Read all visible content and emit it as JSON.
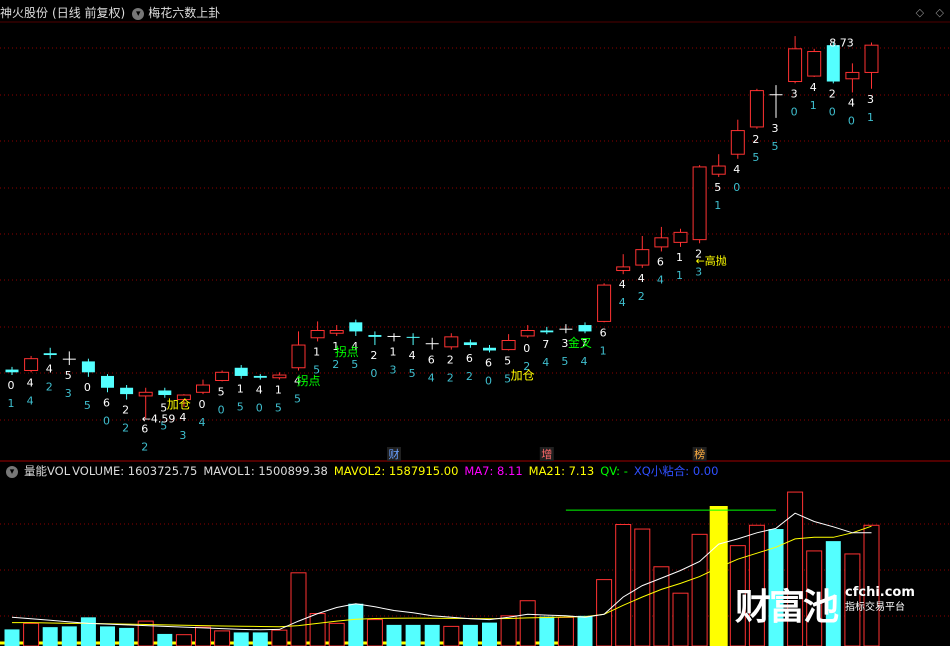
{
  "header": {
    "stock": "神火股份",
    "period": "(日线 前复权)",
    "indicator": "梅花六数上卦"
  },
  "volume_header": {
    "name": "量能VOL",
    "volume": "VOLUME: 1603725.75",
    "mavol1": "MAVOL1: 1500899.38",
    "mavol2": "MAVOL2: 1587915.00",
    "ma7": "MA7: 8.11",
    "ma21": "MA21: 7.13",
    "qv": "QV: -",
    "xq": "XQ小粘合: 0.00"
  },
  "watermark": {
    "brand": "财富池",
    "site": "cfchi.com",
    "tagline": "指标交易平台"
  },
  "colors": {
    "up": "#ff3232",
    "down": "#54ffff",
    "flat": "#ffffff",
    "signal": "#ffff00",
    "guai": "#00ff00",
    "mavol1": "#ffffff",
    "mavol2": "#ffff00",
    "ma7": "#ff00ff",
    "ma21": "#ffff00",
    "xq": "#0000ff",
    "gridline": "#8b0000",
    "annotation_white": "#ffffff"
  },
  "chart_data": [
    {
      "type": "candlestick",
      "price_range": [
        4.3,
        8.9
      ],
      "high_label": "8.73",
      "low_label": "4.59",
      "candles": [
        {
          "o": 5.13,
          "c": 5.1,
          "h": 5.16,
          "l": 5.07,
          "n1": "0",
          "n2": "1"
        },
        {
          "o": 5.12,
          "c": 5.25,
          "h": 5.28,
          "l": 5.1,
          "n1": "4",
          "n2": "4"
        },
        {
          "o": 5.31,
          "c": 5.29,
          "h": 5.37,
          "l": 5.25,
          "n1": "4",
          "n2": "2"
        },
        {
          "o": 5.25,
          "c": 5.25,
          "h": 5.33,
          "l": 5.18,
          "n1": "5",
          "n2": "3"
        },
        {
          "o": 5.22,
          "c": 5.1,
          "h": 5.25,
          "l": 5.05,
          "n1": "0",
          "n2": "5"
        },
        {
          "o": 5.06,
          "c": 4.93,
          "h": 5.08,
          "l": 4.88,
          "n1": "6",
          "n2": "0"
        },
        {
          "o": 4.93,
          "c": 4.86,
          "h": 4.96,
          "l": 4.8,
          "n1": "2",
          "n2": "2"
        },
        {
          "o": 4.84,
          "c": 4.88,
          "h": 4.93,
          "l": 4.59,
          "n1": "6",
          "n2": "2"
        },
        {
          "o": 4.9,
          "c": 4.85,
          "h": 4.93,
          "l": 4.82,
          "n1": "5",
          "n2": "5"
        },
        {
          "o": 4.8,
          "c": 4.85,
          "h": 4.86,
          "l": 4.72,
          "n1": "4",
          "n2": "3"
        },
        {
          "o": 4.88,
          "c": 4.96,
          "h": 5.02,
          "l": 4.86,
          "n1": "0",
          "n2": "4"
        },
        {
          "o": 5.01,
          "c": 5.1,
          "h": 5.12,
          "l": 5.0,
          "n1": "5",
          "n2": "0"
        },
        {
          "o": 5.15,
          "c": 5.06,
          "h": 5.18,
          "l": 5.03,
          "n1": "1",
          "n2": "5"
        },
        {
          "o": 5.06,
          "c": 5.04,
          "h": 5.08,
          "l": 5.02,
          "n1": "4",
          "n2": "0"
        },
        {
          "o": 5.04,
          "c": 5.07,
          "h": 5.1,
          "l": 5.02,
          "n1": "1",
          "n2": "5"
        },
        {
          "o": 5.15,
          "c": 5.4,
          "h": 5.55,
          "l": 5.12,
          "n1": "4",
          "n2": "5"
        },
        {
          "o": 5.48,
          "c": 5.56,
          "h": 5.66,
          "l": 5.44,
          "n1": "1",
          "n2": "5"
        },
        {
          "o": 5.53,
          "c": 5.56,
          "h": 5.62,
          "l": 5.5,
          "n1": "1",
          "n2": "2"
        },
        {
          "o": 5.65,
          "c": 5.55,
          "h": 5.68,
          "l": 5.5,
          "n1": "4",
          "n2": "5"
        },
        {
          "o": 5.51,
          "c": 5.49,
          "h": 5.55,
          "l": 5.4,
          "n1": "2",
          "n2": "0"
        },
        {
          "o": 5.5,
          "c": 5.5,
          "h": 5.53,
          "l": 5.44,
          "n1": "1",
          "n2": "3"
        },
        {
          "o": 5.49,
          "c": 5.48,
          "h": 5.53,
          "l": 5.4,
          "n1": "4",
          "n2": "5"
        },
        {
          "o": 5.42,
          "c": 5.42,
          "h": 5.48,
          "l": 5.35,
          "n1": "6",
          "n2": "4"
        },
        {
          "o": 5.38,
          "c": 5.49,
          "h": 5.53,
          "l": 5.35,
          "n1": "2",
          "n2": "2"
        },
        {
          "o": 5.43,
          "c": 5.4,
          "h": 5.46,
          "l": 5.37,
          "n1": "6",
          "n2": "2"
        },
        {
          "o": 5.37,
          "c": 5.34,
          "h": 5.4,
          "l": 5.32,
          "n1": "6",
          "n2": "0"
        },
        {
          "o": 5.35,
          "c": 5.45,
          "h": 5.52,
          "l": 5.34,
          "n1": "5",
          "n2": "5"
        },
        {
          "o": 5.5,
          "c": 5.56,
          "h": 5.62,
          "l": 5.48,
          "n1": "0",
          "n2": "2"
        },
        {
          "o": 5.56,
          "c": 5.54,
          "h": 5.6,
          "l": 5.52,
          "n1": "7",
          "n2": "4"
        },
        {
          "o": 5.58,
          "c": 5.58,
          "h": 5.63,
          "l": 5.53,
          "n1": "3",
          "n2": "5"
        },
        {
          "o": 5.62,
          "c": 5.55,
          "h": 5.65,
          "l": 5.53,
          "n1": "7",
          "n2": "4"
        },
        {
          "o": 5.66,
          "c": 6.06,
          "h": 6.08,
          "l": 5.65,
          "n1": "6",
          "n2": "1"
        },
        {
          "o": 6.22,
          "c": 6.26,
          "h": 6.4,
          "l": 6.18,
          "n1": "4",
          "n2": "4"
        },
        {
          "o": 6.28,
          "c": 6.45,
          "h": 6.6,
          "l": 6.25,
          "n1": "4",
          "n2": "2"
        },
        {
          "o": 6.48,
          "c": 6.58,
          "h": 6.7,
          "l": 6.43,
          "n1": "6",
          "n2": "4"
        },
        {
          "o": 6.53,
          "c": 6.64,
          "h": 6.68,
          "l": 6.48,
          "n1": "1",
          "n2": "1"
        },
        {
          "o": 6.56,
          "c": 7.36,
          "h": 7.38,
          "l": 6.52,
          "n1": "2",
          "n2": "3"
        },
        {
          "o": 7.28,
          "c": 7.37,
          "h": 7.5,
          "l": 7.25,
          "n1": "5",
          "n2": "1"
        },
        {
          "o": 7.5,
          "c": 7.76,
          "h": 7.88,
          "l": 7.45,
          "n1": "4",
          "n2": "0"
        },
        {
          "o": 7.8,
          "c": 8.2,
          "h": 8.22,
          "l": 7.78,
          "n1": "2",
          "n2": "5"
        },
        {
          "o": 8.16,
          "c": 8.16,
          "h": 8.26,
          "l": 7.9,
          "n1": "3",
          "n2": "5"
        },
        {
          "o": 8.3,
          "c": 8.66,
          "h": 8.8,
          "l": 8.28,
          "n1": "3",
          "n2": "0"
        },
        {
          "o": 8.36,
          "c": 8.63,
          "h": 8.66,
          "l": 8.35,
          "n1": "4",
          "n2": "1"
        },
        {
          "o": 8.7,
          "c": 8.3,
          "h": 8.73,
          "l": 8.28,
          "n1": "2",
          "n2": "0"
        },
        {
          "o": 8.33,
          "c": 8.4,
          "h": 8.5,
          "l": 8.18,
          "n1": "4",
          "n2": "0"
        },
        {
          "o": 8.4,
          "c": 8.7,
          "h": 8.73,
          "l": 8.22,
          "n1": "3",
          "n2": "1"
        }
      ],
      "signals": [
        {
          "label": "加仓",
          "index": 8,
          "price": 4.7
        },
        {
          "label": "加仓",
          "index": 26,
          "price": 5.02
        },
        {
          "label": "金叉",
          "index": 29,
          "price": 5.38
        }
      ],
      "guaidian": [
        {
          "label": "拐点",
          "index": 15,
          "price": 4.96
        },
        {
          "label": "拐点",
          "index": 17,
          "price": 5.28
        }
      ],
      "annotations": [
        {
          "label": "←高抛",
          "index": 36,
          "price": 6.33
        },
        {
          "label": "8.73",
          "index": 43,
          "price": 8.73
        },
        {
          "label": "←4.59",
          "index": 7,
          "price": 4.59
        }
      ],
      "markers": [
        {
          "label": "财",
          "index": 20,
          "color": "#6aa0ff"
        },
        {
          "label": "增",
          "index": 28,
          "color": "#ff6a6a"
        },
        {
          "label": "榜",
          "index": 36,
          "color": "#ffae40"
        }
      ]
    },
    {
      "type": "bar",
      "name": "VOLUME",
      "range": [
        0,
        2200000
      ],
      "values": [
        {
          "v": 220000,
          "up": false
        },
        {
          "v": 300000,
          "up": true
        },
        {
          "v": 250000,
          "up": false
        },
        {
          "v": 260000,
          "up": false
        },
        {
          "v": 380000,
          "up": false
        },
        {
          "v": 260000,
          "up": false
        },
        {
          "v": 240000,
          "up": false
        },
        {
          "v": 330000,
          "up": true
        },
        {
          "v": 160000,
          "up": false
        },
        {
          "v": 150000,
          "up": true
        },
        {
          "v": 250000,
          "up": true
        },
        {
          "v": 200000,
          "up": true
        },
        {
          "v": 180000,
          "up": false
        },
        {
          "v": 180000,
          "up": false
        },
        {
          "v": 210000,
          "up": true
        },
        {
          "v": 970000,
          "up": true
        },
        {
          "v": 430000,
          "up": true
        },
        {
          "v": 300000,
          "up": true
        },
        {
          "v": 560000,
          "up": false
        },
        {
          "v": 350000,
          "up": true
        },
        {
          "v": 280000,
          "up": false
        },
        {
          "v": 280000,
          "up": false
        },
        {
          "v": 280000,
          "up": false
        },
        {
          "v": 260000,
          "up": true
        },
        {
          "v": 280000,
          "up": false
        },
        {
          "v": 310000,
          "up": false
        },
        {
          "v": 400000,
          "up": true
        },
        {
          "v": 600000,
          "up": true
        },
        {
          "v": 390000,
          "up": false
        },
        {
          "v": 380000,
          "up": true
        },
        {
          "v": 400000,
          "up": false
        },
        {
          "v": 880000,
          "up": true
        },
        {
          "v": 1610000,
          "up": true
        },
        {
          "v": 1550000,
          "up": true
        },
        {
          "v": 1050000,
          "up": true
        },
        {
          "v": 700000,
          "up": true
        },
        {
          "v": 1480000,
          "up": true
        },
        {
          "v": 1400000,
          "up": true
        },
        {
          "v": 1330000,
          "up": true
        },
        {
          "v": 1600000,
          "up": true
        },
        {
          "v": 1550000,
          "up": false
        },
        {
          "v": 2040000,
          "up": true
        },
        {
          "v": 1260000,
          "up": true
        },
        {
          "v": 1390000,
          "up": false
        },
        {
          "v": 1220000,
          "up": true
        },
        {
          "v": 1600000,
          "up": true
        }
      ],
      "mavol1": [
        380000,
        360000,
        340000,
        320000,
        300000,
        290000,
        280000,
        270000,
        260000,
        250000,
        240000,
        230000,
        220000,
        215000,
        220000,
        330000,
        430000,
        510000,
        560000,
        520000,
        470000,
        440000,
        400000,
        380000,
        360000,
        350000,
        380000,
        420000,
        410000,
        400000,
        380000,
        420000,
        650000,
        800000,
        900000,
        1000000,
        1120000,
        1350000,
        1420000,
        1500000,
        1560000,
        1760000,
        1650000,
        1580000,
        1500000,
        1500900
      ],
      "mavol2": [
        310000,
        310000,
        305000,
        300000,
        300000,
        295000,
        290000,
        285000,
        280000,
        275000,
        270000,
        265000,
        262000,
        258000,
        255000,
        270000,
        300000,
        330000,
        355000,
        365000,
        368000,
        370000,
        368000,
        366000,
        364000,
        362000,
        365000,
        372000,
        378000,
        384000,
        388000,
        420000,
        540000,
        650000,
        750000,
        830000,
        920000,
        1040000,
        1150000,
        1230000,
        1310000,
        1420000,
        1440000,
        1440000,
        1500000,
        1587915
      ],
      "hline": {
        "value": 1800000,
        "from_index": 29,
        "to_index": 40
      },
      "hl_bar_index": 37,
      "baseline_end_index": 29
    }
  ]
}
